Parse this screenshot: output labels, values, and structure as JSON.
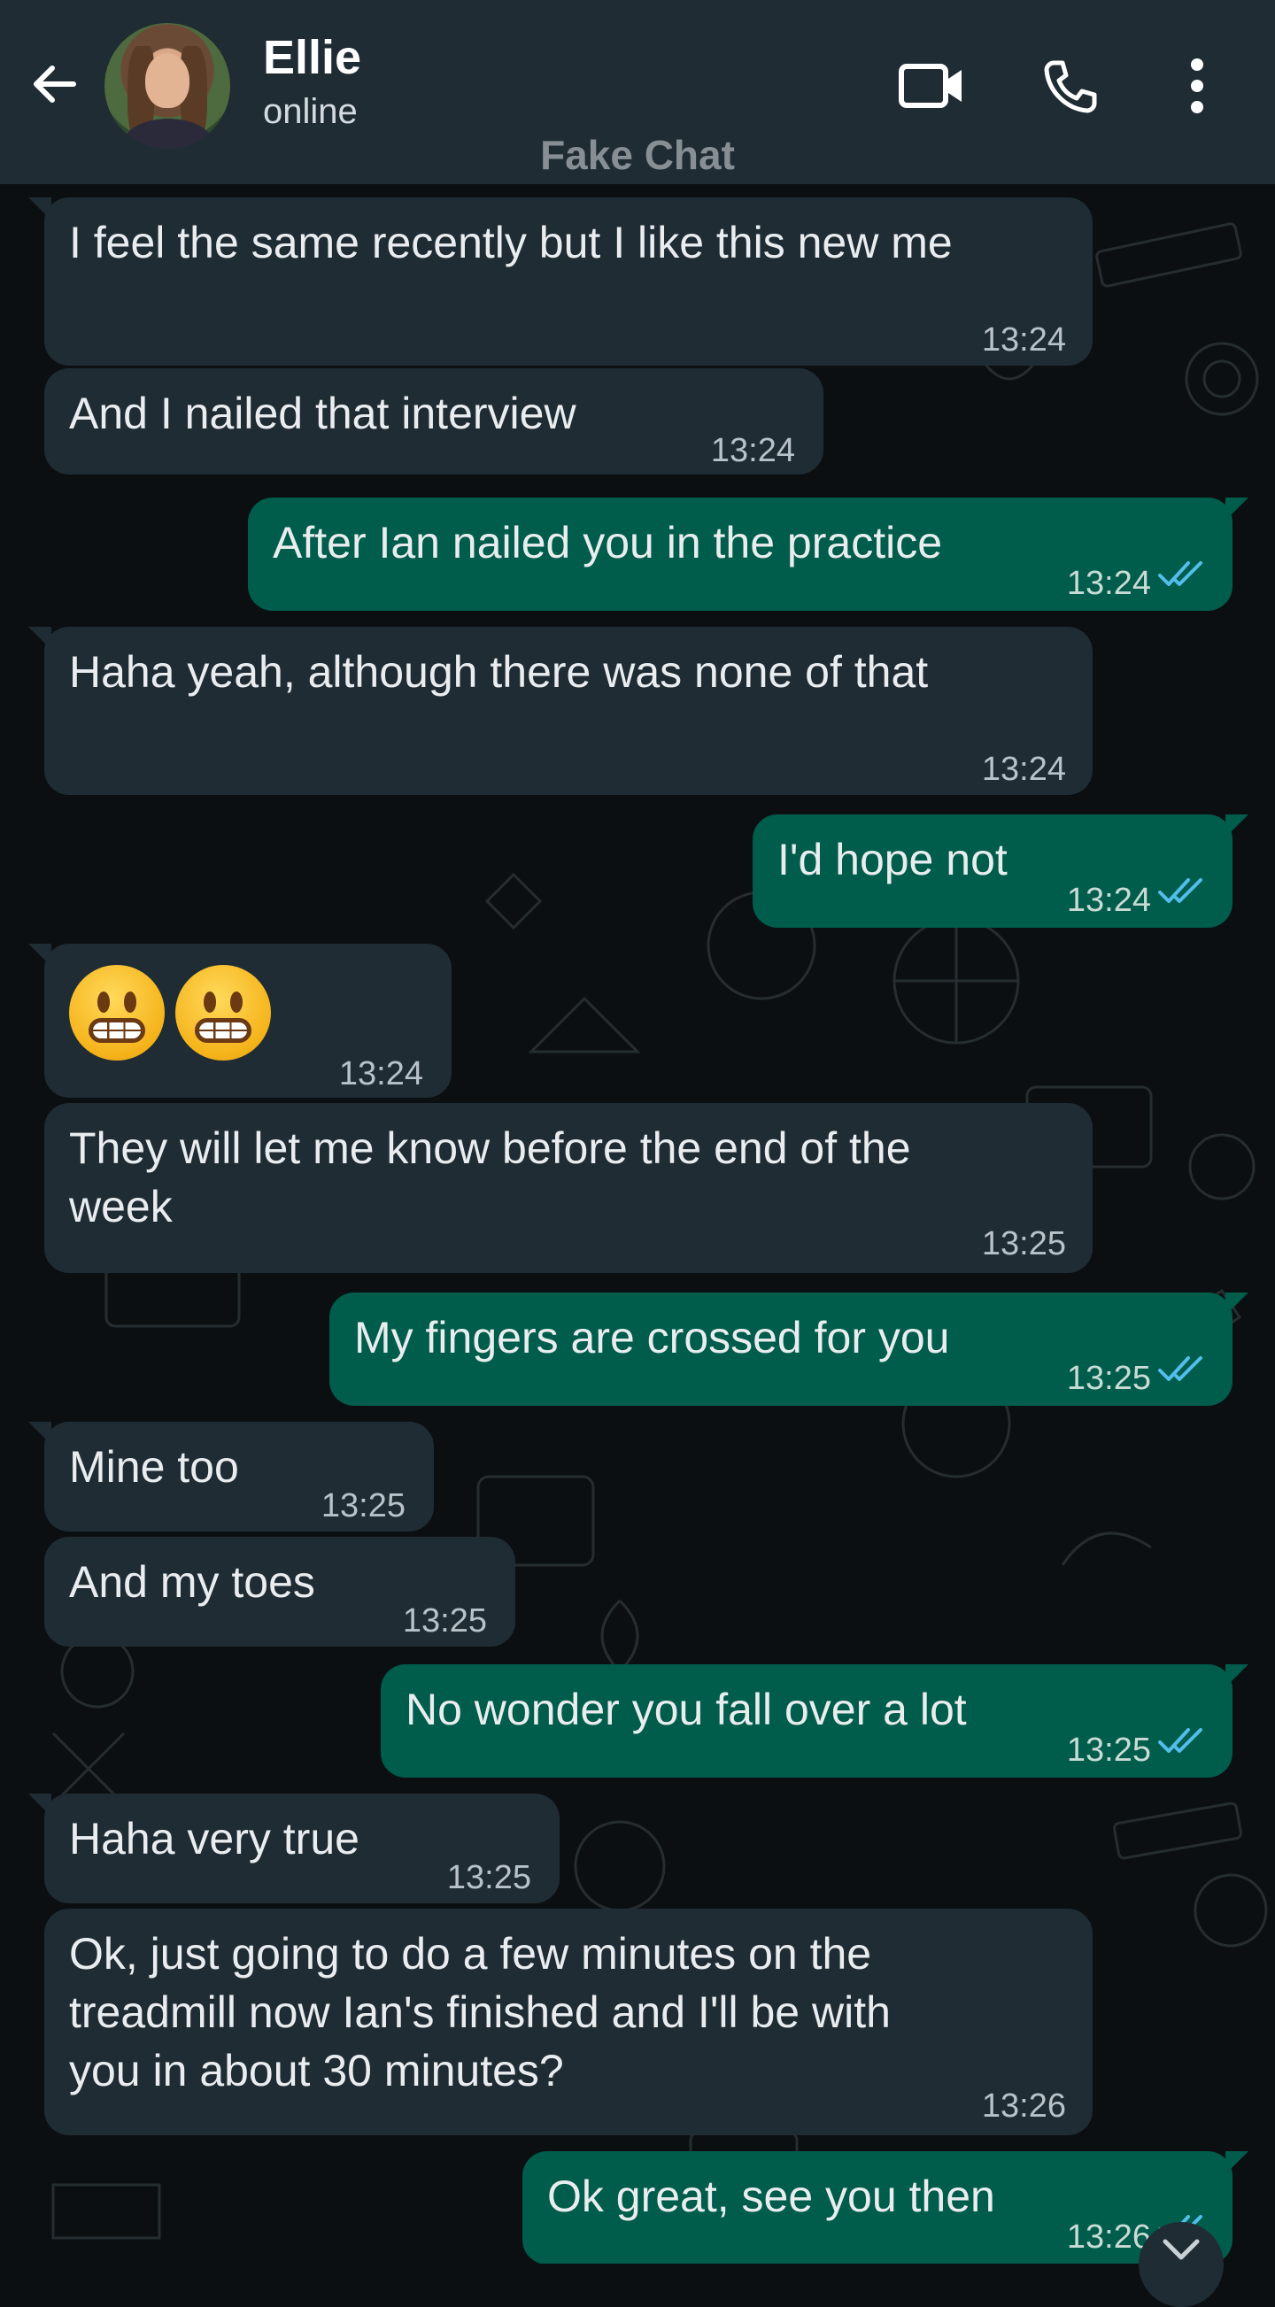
{
  "header": {
    "contact_name": "Ellie",
    "status": "online",
    "watermark": "Fake Chat",
    "icons": [
      "back-arrow-icon",
      "avatar",
      "video-call-icon",
      "phone-icon",
      "more-vert-icon"
    ]
  },
  "colors": {
    "header_bg": "#1f2c34",
    "chat_bg": "#0b0f12",
    "incoming_bubble": "#1f2c34",
    "outgoing_bubble": "#005c4b",
    "read_tick": "#53bdeb"
  },
  "messages": [
    {
      "direction": "in",
      "text": "I feel the same recently but I like this new me",
      "time": "13:24"
    },
    {
      "direction": "in",
      "text": "And I nailed that interview",
      "time": "13:24"
    },
    {
      "direction": "out",
      "text": "After Ian nailed you in the practice",
      "time": "13:24",
      "status": "read"
    },
    {
      "direction": "in",
      "text": "Haha yeah, although there was none of that",
      "time": "13:24"
    },
    {
      "direction": "out",
      "text": "I'd hope not",
      "time": "13:24",
      "status": "read"
    },
    {
      "direction": "in",
      "text": "😬😬",
      "time": "13:24",
      "emoji": "grimacing-face"
    },
    {
      "direction": "in",
      "text": "They will let me know before the end of the\nweek",
      "time": "13:25"
    },
    {
      "direction": "out",
      "text": "My fingers are crossed for you",
      "time": "13:25",
      "status": "read"
    },
    {
      "direction": "in",
      "text": "Mine too",
      "time": "13:25"
    },
    {
      "direction": "in",
      "text": "And my toes",
      "time": "13:25"
    },
    {
      "direction": "out",
      "text": "No wonder you fall over a lot",
      "time": "13:25",
      "status": "read"
    },
    {
      "direction": "in",
      "text": "Haha very true",
      "time": "13:25"
    },
    {
      "direction": "in",
      "text": "Ok, just going to do a few minutes on the\ntreadmill now Ian's finished and I'll be with\nyou in about 30 minutes?",
      "time": "13:26"
    },
    {
      "direction": "out",
      "text": "Ok great, see you then",
      "time": "13:26",
      "status": "read"
    }
  ]
}
